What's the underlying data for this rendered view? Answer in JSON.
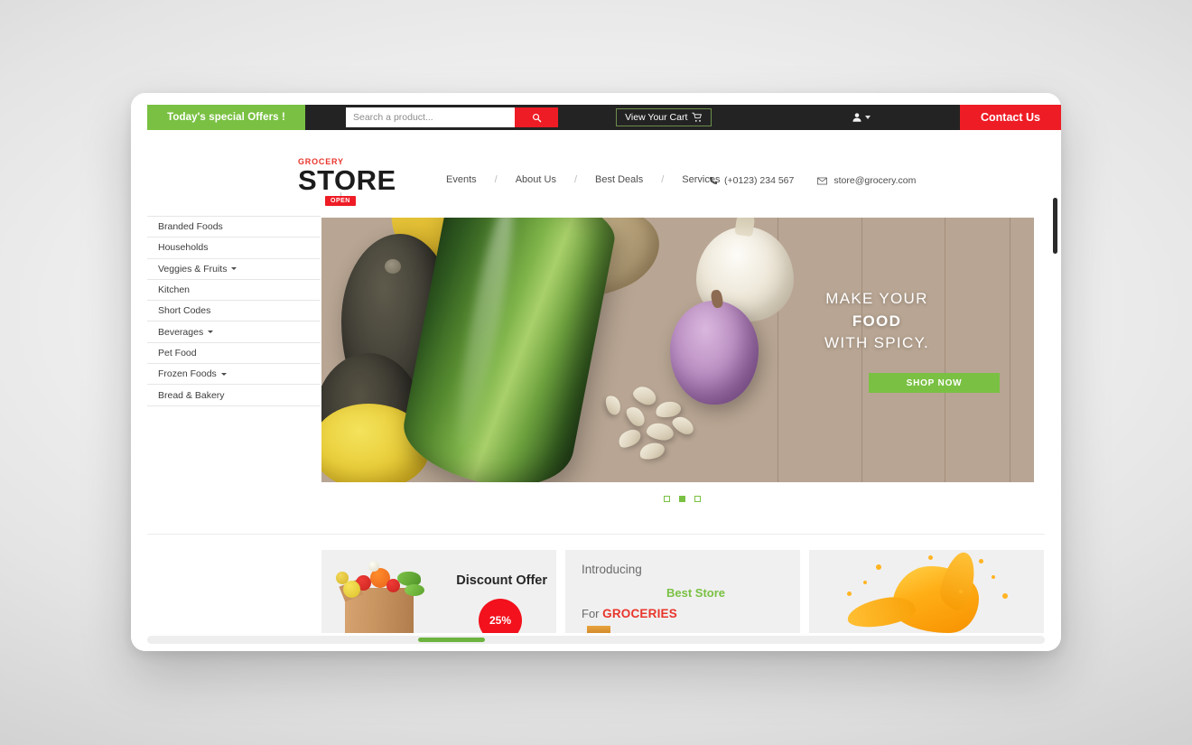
{
  "topbar": {
    "offers_label": "Today's special Offers !",
    "search_placeholder": "Search a product...",
    "search_value": "",
    "search_icon": "search-icon",
    "cart_label": "View Your Cart",
    "cart_icon": "shopping-cart-icon",
    "account_icon": "user-account-icon",
    "account_caret_icon": "chevron-down-icon",
    "contact_label": "Contact Us"
  },
  "logo": {
    "eyebrow": "GROCERY",
    "name": "STORE",
    "badge": "OPEN"
  },
  "nav": {
    "separator": "/",
    "items": [
      {
        "label": "Events"
      },
      {
        "label": "About Us"
      },
      {
        "label": "Best Deals"
      },
      {
        "label": "Services"
      }
    ]
  },
  "contact_info": {
    "phone_icon": "phone-icon",
    "phone": "(+0123) 234 567",
    "email_icon": "envelope-icon",
    "email": "store@grocery.com"
  },
  "sidebar": {
    "items": [
      {
        "label": "Branded Foods",
        "has_dropdown": false
      },
      {
        "label": "Households",
        "has_dropdown": false
      },
      {
        "label": "Veggies & Fruits",
        "has_dropdown": true
      },
      {
        "label": "Kitchen",
        "has_dropdown": false
      },
      {
        "label": "Short Codes",
        "has_dropdown": false
      },
      {
        "label": "Beverages",
        "has_dropdown": true
      },
      {
        "label": "Pet Food",
        "has_dropdown": false
      },
      {
        "label": "Frozen Foods",
        "has_dropdown": true
      },
      {
        "label": "Bread & Bakery",
        "has_dropdown": false
      }
    ]
  },
  "hero": {
    "line1": "MAKE YOUR",
    "line2": "FOOD",
    "line3": "WITH SPICY.",
    "cta_label": "SHOP NOW",
    "slides_total": 3,
    "active_slide": 2
  },
  "promos": [
    {
      "title": "Discount Offer",
      "badge": "25%"
    },
    {
      "line1": "Introducing",
      "line2": "Best Store",
      "line3_prefix": "For ",
      "line3_strong": "GROCERIES"
    },
    {
      "title": ""
    }
  ],
  "colors": {
    "green": "#7ac143",
    "red": "#ee1c25",
    "badge_red": "#f2111c",
    "dark": "#232323",
    "logo_red": "#e8352b",
    "text_gray": "#4e4e4e"
  }
}
